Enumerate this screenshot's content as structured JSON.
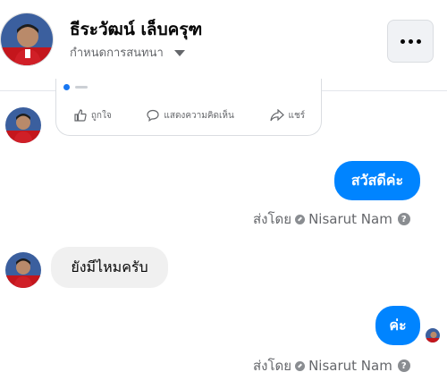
{
  "header": {
    "name": "ธีระวัฒน์ เล็บครุฑ",
    "manage_label": "กำหนดการสนทนา",
    "more_icon": "more-horizontal-icon"
  },
  "shared_post": {
    "actions": [
      {
        "icon": "thumbs-up-icon",
        "label": "ถูกใจ"
      },
      {
        "icon": "comment-icon",
        "label": "แสดงความคิดเห็น"
      },
      {
        "icon": "share-icon",
        "label": "แชร์"
      }
    ]
  },
  "thread": {
    "messages": [
      {
        "direction": "outgoing",
        "text": "สวัสดีค่ะ"
      },
      {
        "direction": "incoming",
        "text": "ยังมีไหมครับ"
      },
      {
        "direction": "outgoing",
        "text": "ค่ะ"
      }
    ],
    "sent_by_prefix": "ส่งโดย",
    "sender_name": "Nisarut Nam",
    "help_glyph": "?"
  },
  "colors": {
    "outgoing_bubble": "#0084ff",
    "incoming_bubble": "#f0f0f0",
    "secondary_text": "#65676b"
  }
}
